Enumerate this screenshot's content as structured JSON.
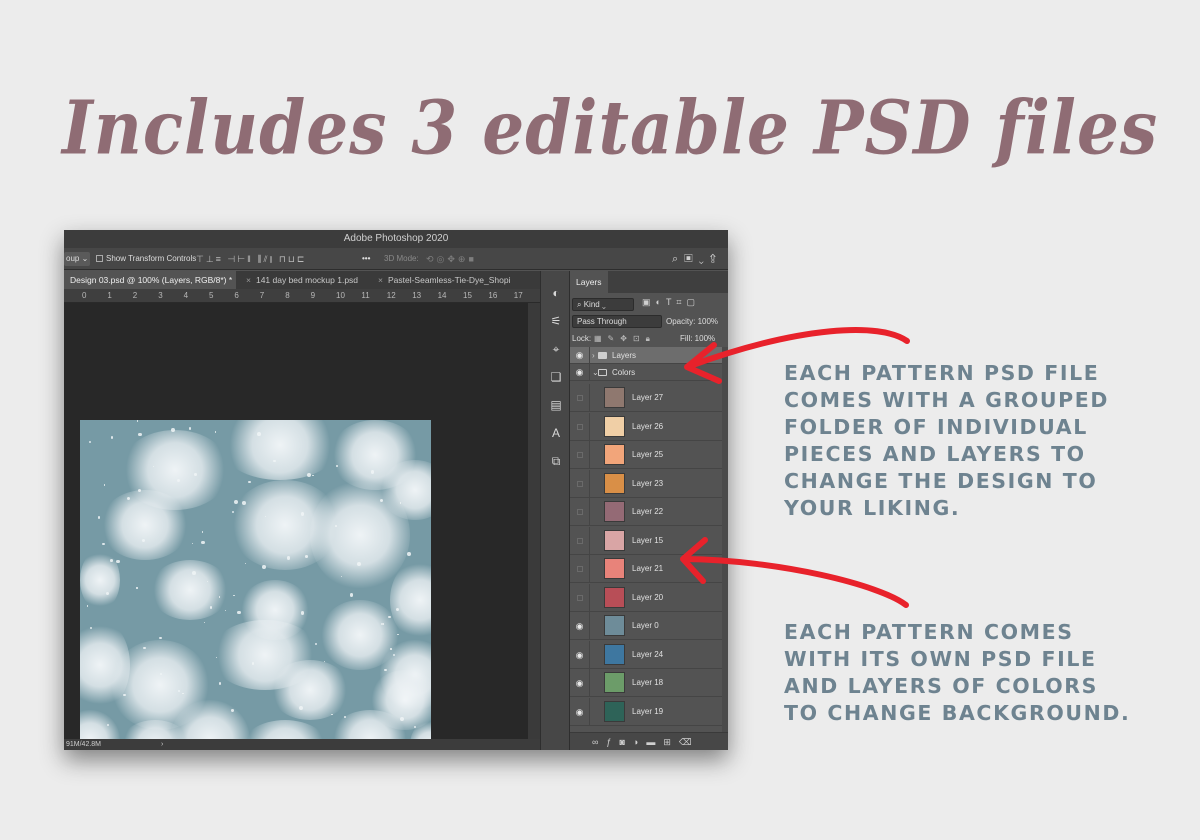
{
  "headline": "Includes 3 editable PSD files",
  "app": {
    "title": "Adobe Photoshop 2020",
    "options_bar": {
      "group_dropdown": "oup",
      "show_transform_label": "Show Transform Controls",
      "more_label": "•••",
      "mode_3d_label": "3D Mode:"
    },
    "tabs": [
      {
        "label": "Design 03.psd @ 100% (Layers, RGB/8*) *",
        "active": true
      },
      {
        "label": "141 day bed mockup 1.psd",
        "active": false
      },
      {
        "label": "Pastel-Seamless-Tie-Dye_Shopi",
        "active": false
      }
    ],
    "tab_overflow": "»",
    "ruler_numbers": [
      "0",
      "1",
      "2",
      "3",
      "4",
      "5",
      "6",
      "7",
      "8",
      "9",
      "10",
      "11",
      "12",
      "13",
      "14",
      "15",
      "16",
      "17"
    ],
    "status": {
      "doc_size": "91M/42.8M",
      "chevron": "›"
    }
  },
  "layers_panel": {
    "tab_label": "Layers",
    "filter_kind": "Kind",
    "blend_mode": "Pass Through",
    "opacity_label": "Opacity: 100%",
    "lock_label": "Lock:",
    "fill_label": "Fill: 100%",
    "groups": [
      {
        "label": "Layers",
        "expanded": false,
        "visible": true
      },
      {
        "label": "Colors",
        "expanded": true,
        "visible": true
      }
    ],
    "layers": [
      {
        "name": "Layer 27",
        "color": "#8f786f",
        "visible": false
      },
      {
        "name": "Layer 26",
        "color": "#f0cfa6",
        "visible": false
      },
      {
        "name": "Layer 25",
        "color": "#f2a57a",
        "visible": false
      },
      {
        "name": "Layer 23",
        "color": "#d98f47",
        "visible": false
      },
      {
        "name": "Layer 22",
        "color": "#946a75",
        "visible": false
      },
      {
        "name": "Layer 15",
        "color": "#d9a5a5",
        "visible": false
      },
      {
        "name": "Layer 21",
        "color": "#e8837a",
        "visible": false
      },
      {
        "name": "Layer 20",
        "color": "#b84e57",
        "visible": false
      },
      {
        "name": "Layer 0",
        "color": "#6e8c99",
        "visible": true
      },
      {
        "name": "Layer 24",
        "color": "#3e77a0",
        "visible": true
      },
      {
        "name": "Layer 18",
        "color": "#6c9c69",
        "visible": true
      },
      {
        "name": "Layer 19",
        "color": "#2e6358",
        "visible": true
      }
    ]
  },
  "annotations": [
    "EACH PATTERN PSD FILE\nCOMES WITH A GROUPED\nFOLDER OF INDIVIDUAL\nPIECES AND LAYERS TO\nCHANGE THE DESIGN TO\nYOUR LIKING.",
    "EACH PATTERN COMES\nWITH ITS OWN PSD FILE\nAND LAYERS OF COLORS\nTO CHANGE BACKGROUND."
  ],
  "colors": {
    "headline": "#8f6c74",
    "annotation_text": "#6e8390",
    "arrow": "#e8222b",
    "canvas_pattern": "#769aa5"
  }
}
